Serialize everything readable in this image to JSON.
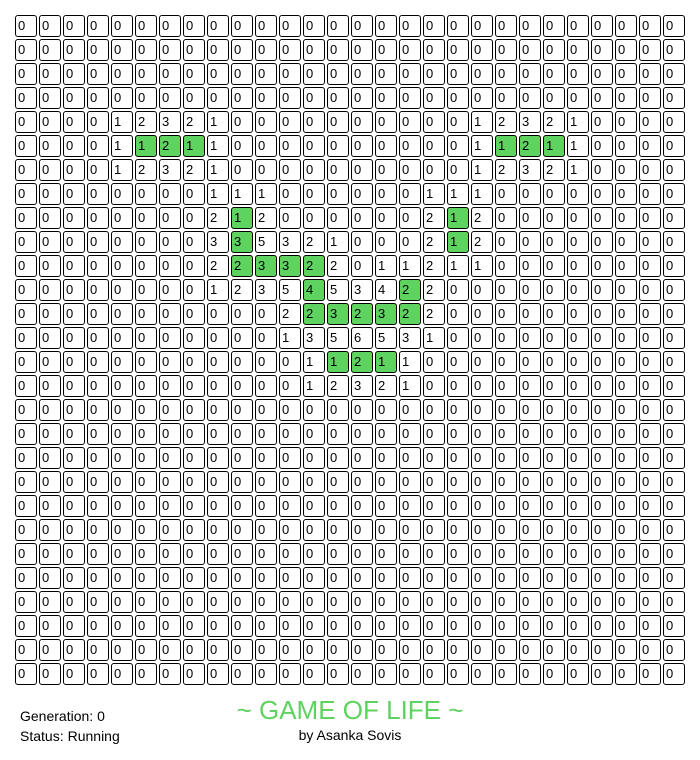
{
  "title": "~ GAME OF LIFE ~",
  "author": "by Asanka Sovis",
  "status": {
    "generation_label": "Generation:",
    "generation_value": "0",
    "status_label": "Status:",
    "status_value": "Running"
  },
  "colors": {
    "alive": "#5fd35f",
    "dead": "#ffffff",
    "border": "#000000",
    "title": "#5fd35f"
  },
  "grid": {
    "rows": 28,
    "cols": 28,
    "counts": [
      [
        0,
        0,
        0,
        0,
        0,
        0,
        0,
        0,
        0,
        0,
        0,
        0,
        0,
        0,
        0,
        0,
        0,
        0,
        0,
        0,
        0,
        0,
        0,
        0,
        0,
        0,
        0,
        0
      ],
      [
        0,
        0,
        0,
        0,
        0,
        0,
        0,
        0,
        0,
        0,
        0,
        0,
        0,
        0,
        0,
        0,
        0,
        0,
        0,
        0,
        0,
        0,
        0,
        0,
        0,
        0,
        0,
        0
      ],
      [
        0,
        0,
        0,
        0,
        0,
        0,
        0,
        0,
        0,
        0,
        0,
        0,
        0,
        0,
        0,
        0,
        0,
        0,
        0,
        0,
        0,
        0,
        0,
        0,
        0,
        0,
        0,
        0
      ],
      [
        0,
        0,
        0,
        0,
        0,
        0,
        0,
        0,
        0,
        0,
        0,
        0,
        0,
        0,
        0,
        0,
        0,
        0,
        0,
        0,
        0,
        0,
        0,
        0,
        0,
        0,
        0,
        0
      ],
      [
        0,
        0,
        0,
        0,
        1,
        2,
        3,
        2,
        1,
        0,
        0,
        0,
        0,
        0,
        0,
        0,
        0,
        0,
        0,
        1,
        2,
        3,
        2,
        1,
        0,
        0,
        0,
        0
      ],
      [
        0,
        0,
        0,
        0,
        1,
        1,
        2,
        1,
        1,
        0,
        0,
        0,
        0,
        0,
        0,
        0,
        0,
        0,
        0,
        1,
        1,
        2,
        1,
        1,
        0,
        0,
        0,
        0
      ],
      [
        0,
        0,
        0,
        0,
        1,
        2,
        3,
        2,
        1,
        0,
        0,
        0,
        0,
        0,
        0,
        0,
        0,
        0,
        0,
        1,
        2,
        3,
        2,
        1,
        0,
        0,
        0,
        0
      ],
      [
        0,
        0,
        0,
        0,
        0,
        0,
        0,
        0,
        1,
        1,
        1,
        0,
        0,
        0,
        0,
        0,
        0,
        1,
        1,
        1,
        0,
        0,
        0,
        0,
        0,
        0,
        0,
        0
      ],
      [
        0,
        0,
        0,
        0,
        0,
        0,
        0,
        0,
        2,
        1,
        2,
        0,
        0,
        0,
        0,
        0,
        0,
        2,
        1,
        2,
        0,
        0,
        0,
        0,
        0,
        0,
        0,
        0
      ],
      [
        0,
        0,
        0,
        0,
        0,
        0,
        0,
        0,
        3,
        3,
        5,
        3,
        2,
        1,
        0,
        0,
        0,
        2,
        1,
        2,
        0,
        0,
        0,
        0,
        0,
        0,
        0,
        0
      ],
      [
        0,
        0,
        0,
        0,
        0,
        0,
        0,
        0,
        2,
        2,
        3,
        3,
        2,
        2,
        0,
        1,
        1,
        2,
        1,
        1,
        0,
        0,
        0,
        0,
        0,
        0,
        0,
        0
      ],
      [
        0,
        0,
        0,
        0,
        0,
        0,
        0,
        0,
        1,
        2,
        3,
        5,
        4,
        5,
        3,
        4,
        2,
        2,
        0,
        0,
        0,
        0,
        0,
        0,
        0,
        0,
        0,
        0
      ],
      [
        0,
        0,
        0,
        0,
        0,
        0,
        0,
        0,
        0,
        0,
        0,
        2,
        2,
        3,
        2,
        3,
        2,
        2,
        0,
        0,
        0,
        0,
        0,
        0,
        0,
        0,
        0,
        0
      ],
      [
        0,
        0,
        0,
        0,
        0,
        0,
        0,
        0,
        0,
        0,
        0,
        1,
        3,
        5,
        6,
        5,
        3,
        1,
        0,
        0,
        0,
        0,
        0,
        0,
        0,
        0,
        0,
        0
      ],
      [
        0,
        0,
        0,
        0,
        0,
        0,
        0,
        0,
        0,
        0,
        0,
        0,
        1,
        1,
        2,
        1,
        1,
        0,
        0,
        0,
        0,
        0,
        0,
        0,
        0,
        0,
        0,
        0
      ],
      [
        0,
        0,
        0,
        0,
        0,
        0,
        0,
        0,
        0,
        0,
        0,
        0,
        1,
        2,
        3,
        2,
        1,
        0,
        0,
        0,
        0,
        0,
        0,
        0,
        0,
        0,
        0,
        0
      ],
      [
        0,
        0,
        0,
        0,
        0,
        0,
        0,
        0,
        0,
        0,
        0,
        0,
        0,
        0,
        0,
        0,
        0,
        0,
        0,
        0,
        0,
        0,
        0,
        0,
        0,
        0,
        0,
        0
      ],
      [
        0,
        0,
        0,
        0,
        0,
        0,
        0,
        0,
        0,
        0,
        0,
        0,
        0,
        0,
        0,
        0,
        0,
        0,
        0,
        0,
        0,
        0,
        0,
        0,
        0,
        0,
        0,
        0
      ],
      [
        0,
        0,
        0,
        0,
        0,
        0,
        0,
        0,
        0,
        0,
        0,
        0,
        0,
        0,
        0,
        0,
        0,
        0,
        0,
        0,
        0,
        0,
        0,
        0,
        0,
        0,
        0,
        0
      ],
      [
        0,
        0,
        0,
        0,
        0,
        0,
        0,
        0,
        0,
        0,
        0,
        0,
        0,
        0,
        0,
        0,
        0,
        0,
        0,
        0,
        0,
        0,
        0,
        0,
        0,
        0,
        0,
        0
      ],
      [
        0,
        0,
        0,
        0,
        0,
        0,
        0,
        0,
        0,
        0,
        0,
        0,
        0,
        0,
        0,
        0,
        0,
        0,
        0,
        0,
        0,
        0,
        0,
        0,
        0,
        0,
        0,
        0
      ],
      [
        0,
        0,
        0,
        0,
        0,
        0,
        0,
        0,
        0,
        0,
        0,
        0,
        0,
        0,
        0,
        0,
        0,
        0,
        0,
        0,
        0,
        0,
        0,
        0,
        0,
        0,
        0,
        0
      ],
      [
        0,
        0,
        0,
        0,
        0,
        0,
        0,
        0,
        0,
        0,
        0,
        0,
        0,
        0,
        0,
        0,
        0,
        0,
        0,
        0,
        0,
        0,
        0,
        0,
        0,
        0,
        0,
        0
      ],
      [
        0,
        0,
        0,
        0,
        0,
        0,
        0,
        0,
        0,
        0,
        0,
        0,
        0,
        0,
        0,
        0,
        0,
        0,
        0,
        0,
        0,
        0,
        0,
        0,
        0,
        0,
        0,
        0
      ],
      [
        0,
        0,
        0,
        0,
        0,
        0,
        0,
        0,
        0,
        0,
        0,
        0,
        0,
        0,
        0,
        0,
        0,
        0,
        0,
        0,
        0,
        0,
        0,
        0,
        0,
        0,
        0,
        0
      ],
      [
        0,
        0,
        0,
        0,
        0,
        0,
        0,
        0,
        0,
        0,
        0,
        0,
        0,
        0,
        0,
        0,
        0,
        0,
        0,
        0,
        0,
        0,
        0,
        0,
        0,
        0,
        0,
        0
      ],
      [
        0,
        0,
        0,
        0,
        0,
        0,
        0,
        0,
        0,
        0,
        0,
        0,
        0,
        0,
        0,
        0,
        0,
        0,
        0,
        0,
        0,
        0,
        0,
        0,
        0,
        0,
        0,
        0
      ],
      [
        0,
        0,
        0,
        0,
        0,
        0,
        0,
        0,
        0,
        0,
        0,
        0,
        0,
        0,
        0,
        0,
        0,
        0,
        0,
        0,
        0,
        0,
        0,
        0,
        0,
        0,
        0,
        0
      ]
    ],
    "alive": [
      [
        0,
        0,
        0,
        0,
        0,
        0,
        0,
        0,
        0,
        0,
        0,
        0,
        0,
        0,
        0,
        0,
        0,
        0,
        0,
        0,
        0,
        0,
        0,
        0,
        0,
        0,
        0,
        0
      ],
      [
        0,
        0,
        0,
        0,
        0,
        0,
        0,
        0,
        0,
        0,
        0,
        0,
        0,
        0,
        0,
        0,
        0,
        0,
        0,
        0,
        0,
        0,
        0,
        0,
        0,
        0,
        0,
        0
      ],
      [
        0,
        0,
        0,
        0,
        0,
        0,
        0,
        0,
        0,
        0,
        0,
        0,
        0,
        0,
        0,
        0,
        0,
        0,
        0,
        0,
        0,
        0,
        0,
        0,
        0,
        0,
        0,
        0
      ],
      [
        0,
        0,
        0,
        0,
        0,
        0,
        0,
        0,
        0,
        0,
        0,
        0,
        0,
        0,
        0,
        0,
        0,
        0,
        0,
        0,
        0,
        0,
        0,
        0,
        0,
        0,
        0,
        0
      ],
      [
        0,
        0,
        0,
        0,
        0,
        0,
        0,
        0,
        0,
        0,
        0,
        0,
        0,
        0,
        0,
        0,
        0,
        0,
        0,
        0,
        0,
        0,
        0,
        0,
        0,
        0,
        0,
        0
      ],
      [
        0,
        0,
        0,
        0,
        0,
        1,
        1,
        1,
        0,
        0,
        0,
        0,
        0,
        0,
        0,
        0,
        0,
        0,
        0,
        0,
        1,
        1,
        1,
        0,
        0,
        0,
        0,
        0
      ],
      [
        0,
        0,
        0,
        0,
        0,
        0,
        0,
        0,
        0,
        0,
        0,
        0,
        0,
        0,
        0,
        0,
        0,
        0,
        0,
        0,
        0,
        0,
        0,
        0,
        0,
        0,
        0,
        0
      ],
      [
        0,
        0,
        0,
        0,
        0,
        0,
        0,
        0,
        0,
        0,
        0,
        0,
        0,
        0,
        0,
        0,
        0,
        0,
        0,
        0,
        0,
        0,
        0,
        0,
        0,
        0,
        0,
        0
      ],
      [
        0,
        0,
        0,
        0,
        0,
        0,
        0,
        0,
        0,
        1,
        0,
        0,
        0,
        0,
        0,
        0,
        0,
        0,
        1,
        0,
        0,
        0,
        0,
        0,
        0,
        0,
        0,
        0
      ],
      [
        0,
        0,
        0,
        0,
        0,
        0,
        0,
        0,
        0,
        1,
        0,
        0,
        0,
        0,
        0,
        0,
        0,
        0,
        1,
        0,
        0,
        0,
        0,
        0,
        0,
        0,
        0,
        0
      ],
      [
        0,
        0,
        0,
        0,
        0,
        0,
        0,
        0,
        0,
        1,
        1,
        1,
        1,
        0,
        0,
        0,
        0,
        0,
        0,
        0,
        0,
        0,
        0,
        0,
        0,
        0,
        0,
        0
      ],
      [
        0,
        0,
        0,
        0,
        0,
        0,
        0,
        0,
        0,
        0,
        0,
        0,
        1,
        0,
        0,
        0,
        1,
        0,
        0,
        0,
        0,
        0,
        0,
        0,
        0,
        0,
        0,
        0
      ],
      [
        0,
        0,
        0,
        0,
        0,
        0,
        0,
        0,
        0,
        0,
        0,
        0,
        1,
        1,
        1,
        1,
        1,
        0,
        0,
        0,
        0,
        0,
        0,
        0,
        0,
        0,
        0,
        0
      ],
      [
        0,
        0,
        0,
        0,
        0,
        0,
        0,
        0,
        0,
        0,
        0,
        0,
        0,
        0,
        0,
        0,
        0,
        0,
        0,
        0,
        0,
        0,
        0,
        0,
        0,
        0,
        0,
        0
      ],
      [
        0,
        0,
        0,
        0,
        0,
        0,
        0,
        0,
        0,
        0,
        0,
        0,
        0,
        1,
        1,
        1,
        0,
        0,
        0,
        0,
        0,
        0,
        0,
        0,
        0,
        0,
        0,
        0
      ],
      [
        0,
        0,
        0,
        0,
        0,
        0,
        0,
        0,
        0,
        0,
        0,
        0,
        0,
        0,
        0,
        0,
        0,
        0,
        0,
        0,
        0,
        0,
        0,
        0,
        0,
        0,
        0,
        0
      ],
      [
        0,
        0,
        0,
        0,
        0,
        0,
        0,
        0,
        0,
        0,
        0,
        0,
        0,
        0,
        0,
        0,
        0,
        0,
        0,
        0,
        0,
        0,
        0,
        0,
        0,
        0,
        0,
        0
      ],
      [
        0,
        0,
        0,
        0,
        0,
        0,
        0,
        0,
        0,
        0,
        0,
        0,
        0,
        0,
        0,
        0,
        0,
        0,
        0,
        0,
        0,
        0,
        0,
        0,
        0,
        0,
        0,
        0
      ],
      [
        0,
        0,
        0,
        0,
        0,
        0,
        0,
        0,
        0,
        0,
        0,
        0,
        0,
        0,
        0,
        0,
        0,
        0,
        0,
        0,
        0,
        0,
        0,
        0,
        0,
        0,
        0,
        0
      ],
      [
        0,
        0,
        0,
        0,
        0,
        0,
        0,
        0,
        0,
        0,
        0,
        0,
        0,
        0,
        0,
        0,
        0,
        0,
        0,
        0,
        0,
        0,
        0,
        0,
        0,
        0,
        0,
        0
      ],
      [
        0,
        0,
        0,
        0,
        0,
        0,
        0,
        0,
        0,
        0,
        0,
        0,
        0,
        0,
        0,
        0,
        0,
        0,
        0,
        0,
        0,
        0,
        0,
        0,
        0,
        0,
        0,
        0
      ],
      [
        0,
        0,
        0,
        0,
        0,
        0,
        0,
        0,
        0,
        0,
        0,
        0,
        0,
        0,
        0,
        0,
        0,
        0,
        0,
        0,
        0,
        0,
        0,
        0,
        0,
        0,
        0,
        0
      ],
      [
        0,
        0,
        0,
        0,
        0,
        0,
        0,
        0,
        0,
        0,
        0,
        0,
        0,
        0,
        0,
        0,
        0,
        0,
        0,
        0,
        0,
        0,
        0,
        0,
        0,
        0,
        0,
        0
      ],
      [
        0,
        0,
        0,
        0,
        0,
        0,
        0,
        0,
        0,
        0,
        0,
        0,
        0,
        0,
        0,
        0,
        0,
        0,
        0,
        0,
        0,
        0,
        0,
        0,
        0,
        0,
        0,
        0
      ],
      [
        0,
        0,
        0,
        0,
        0,
        0,
        0,
        0,
        0,
        0,
        0,
        0,
        0,
        0,
        0,
        0,
        0,
        0,
        0,
        0,
        0,
        0,
        0,
        0,
        0,
        0,
        0,
        0
      ],
      [
        0,
        0,
        0,
        0,
        0,
        0,
        0,
        0,
        0,
        0,
        0,
        0,
        0,
        0,
        0,
        0,
        0,
        0,
        0,
        0,
        0,
        0,
        0,
        0,
        0,
        0,
        0,
        0
      ],
      [
        0,
        0,
        0,
        0,
        0,
        0,
        0,
        0,
        0,
        0,
        0,
        0,
        0,
        0,
        0,
        0,
        0,
        0,
        0,
        0,
        0,
        0,
        0,
        0,
        0,
        0,
        0,
        0
      ],
      [
        0,
        0,
        0,
        0,
        0,
        0,
        0,
        0,
        0,
        0,
        0,
        0,
        0,
        0,
        0,
        0,
        0,
        0,
        0,
        0,
        0,
        0,
        0,
        0,
        0,
        0,
        0,
        0
      ]
    ]
  }
}
